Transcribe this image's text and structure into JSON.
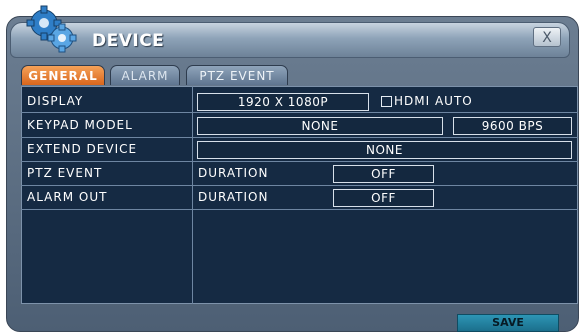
{
  "window": {
    "title": "DEVICE",
    "close_label": "X"
  },
  "tabs": [
    {
      "label": "GENERAL",
      "active": true
    },
    {
      "label": "ALARM",
      "active": false
    },
    {
      "label": "PTZ EVENT",
      "active": false
    }
  ],
  "rows": {
    "display": {
      "label": "DISPLAY",
      "resolution": "1920 X 1080P",
      "hdmi_auto_label": "HDMI AUTO",
      "hdmi_auto_checked": false
    },
    "keypad_model": {
      "label": "KEYPAD MODEL",
      "model": "NONE",
      "baud_rate": "9600 BPS"
    },
    "extend_device": {
      "label": "EXTEND DEVICE",
      "value": "NONE"
    },
    "ptz_event": {
      "label": "PTZ EVENT",
      "duration_label": "DURATION",
      "duration_value": "OFF"
    },
    "alarm_out": {
      "label": "ALARM OUT",
      "duration_label": "DURATION",
      "duration_value": "OFF"
    }
  },
  "footer": {
    "save_label": "SAVE"
  },
  "icons": {
    "title_icon": "gear-icon",
    "close_icon": "close-icon"
  },
  "colors": {
    "active_tab": "#e47a2e",
    "panel_bg": "#152a43",
    "save_button": "#2389a8"
  }
}
